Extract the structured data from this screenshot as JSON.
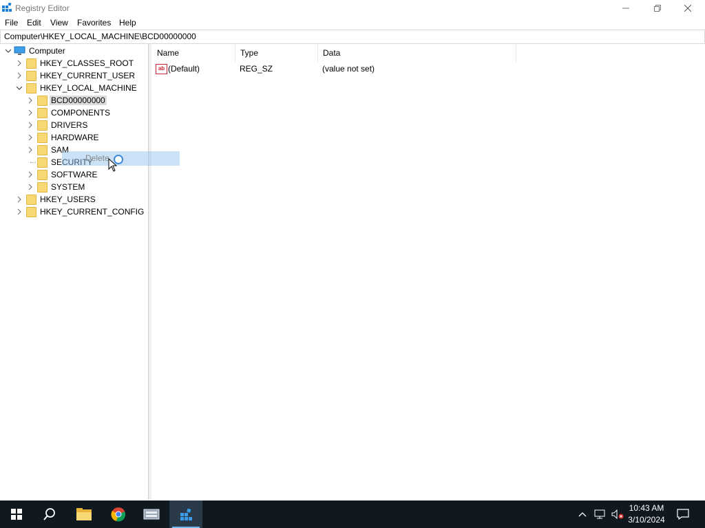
{
  "window": {
    "title": "Registry Editor"
  },
  "menu": {
    "items": [
      "File",
      "Edit",
      "View",
      "Favorites",
      "Help"
    ]
  },
  "address": {
    "path": "Computer\\HKEY_LOCAL_MACHINE\\BCD00000000"
  },
  "tree": {
    "root": "Computer",
    "hives": [
      "HKEY_CLASSES_ROOT",
      "HKEY_CURRENT_USER",
      "HKEY_LOCAL_MACHINE",
      "HKEY_USERS",
      "HKEY_CURRENT_CONFIG"
    ],
    "hklm_children": [
      "BCD00000000",
      "COMPONENTS",
      "DRIVERS",
      "HARDWARE",
      "SAM",
      "SECURITY",
      "SOFTWARE",
      "SYSTEM"
    ],
    "selected": "BCD00000000"
  },
  "drag": {
    "label": "Delete"
  },
  "list": {
    "columns": [
      "Name",
      "Type",
      "Data"
    ],
    "rows": [
      {
        "name": "(Default)",
        "type": "REG_SZ",
        "data": "(value not set)"
      }
    ]
  },
  "taskbar": {
    "time": "10:43 AM",
    "date": "3/10/2024"
  }
}
